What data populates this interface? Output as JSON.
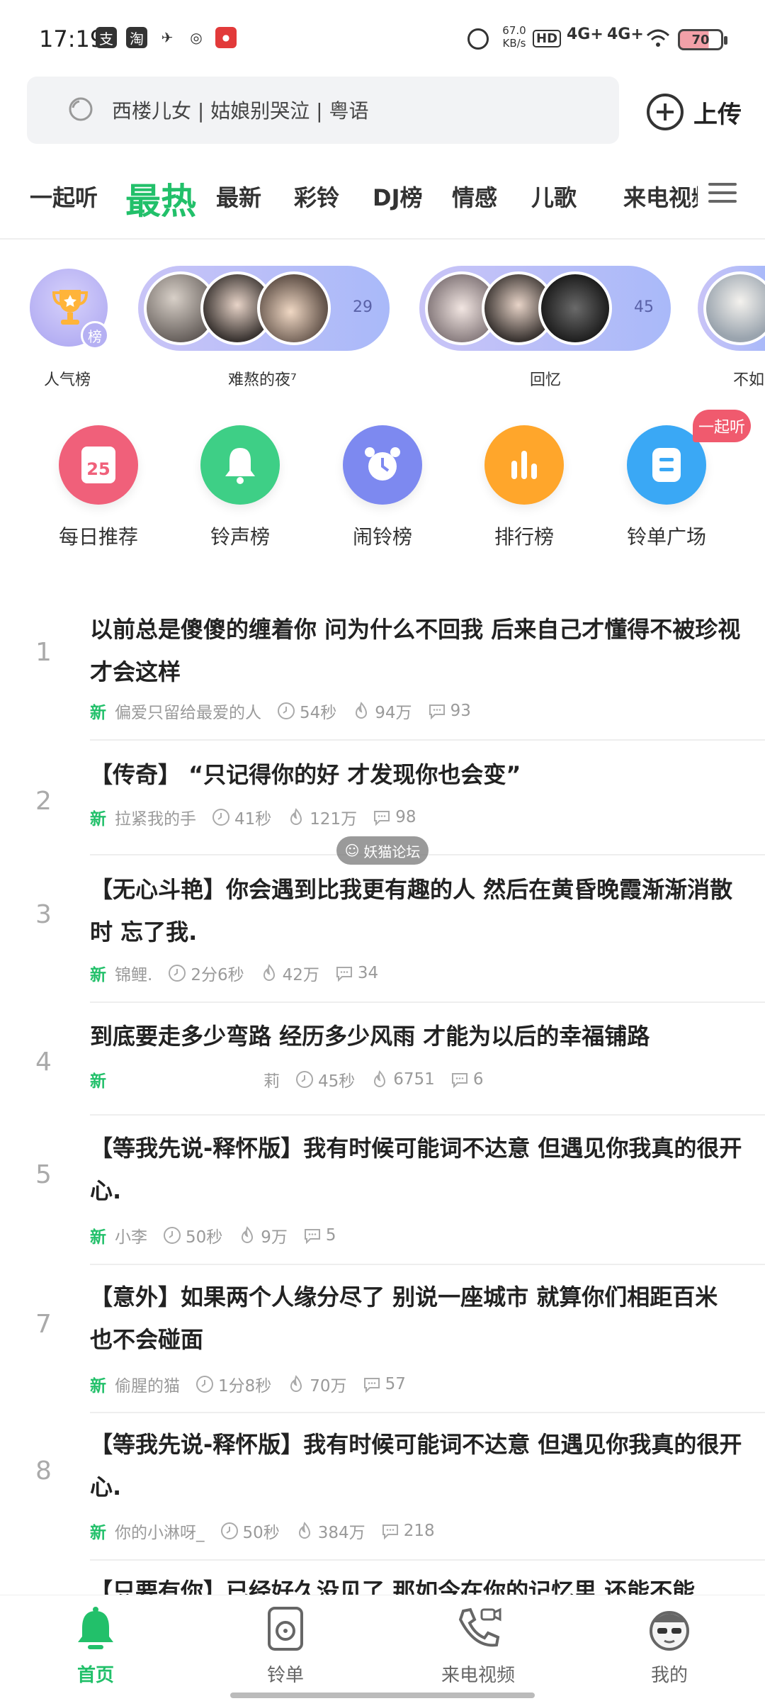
{
  "status_bar": {
    "time": "17:19",
    "net_speed_top": "67.0",
    "net_speed_unit": "KB/s",
    "hd_label": "HD",
    "sim1": "4G+",
    "sim2": "4G+",
    "battery": "70"
  },
  "search": {
    "placeholder": "西楼儿女 | 姑娘别哭泣 | 粤语"
  },
  "upload": {
    "label": "上传"
  },
  "tabs": [
    "一起听",
    "最热",
    "最新",
    "彩铃",
    "DJ榜",
    "情感",
    "儿歌",
    "来电视频"
  ],
  "active_tab": "最热",
  "playlists": [
    {
      "label": "人气榜",
      "badge": "榜"
    },
    {
      "label": "难熬的夜⁷",
      "count": "29"
    },
    {
      "label": "回忆",
      "count": "45"
    },
    {
      "label": "不如"
    }
  ],
  "categories": [
    {
      "label": "每日推荐",
      "icon_text": "25",
      "color": "#f0607a"
    },
    {
      "label": "铃声榜",
      "color": "#3ecf86"
    },
    {
      "label": "闹铃榜",
      "color": "#7d89f0"
    },
    {
      "label": "排行榜",
      "color": "#ffa62b"
    },
    {
      "label": "铃单广场",
      "color": "#3aa8f5",
      "badge": "一起听"
    }
  ],
  "songs": [
    {
      "rank": "1",
      "title": "以前总是傻傻的缠着你  问为什么不回我  后来自己才懂得不被珍视才会这样",
      "new": "新",
      "author": "偏爱只留给最爱的人",
      "duration": "54秒",
      "plays": "94万",
      "comments": "93"
    },
    {
      "rank": "2",
      "title": "【传奇】 “只记得你的好 才发现你也会变”",
      "new": "新",
      "author": "拉紧我的手",
      "duration": "41秒",
      "plays": "121万",
      "comments": "98"
    },
    {
      "rank": "3",
      "title": "【无心斗艳】你会遇到比我更有趣的人 然后在黄昏晚霞渐渐消散时 忘了我.",
      "new": "新",
      "author": "锦鲤.",
      "duration": "2分6秒",
      "plays": "42万",
      "comments": "34"
    },
    {
      "rank": "4",
      "title": "到底要走多少弯路 经历多少风雨 才能为以后的幸福铺路",
      "new": "新",
      "author": "莉",
      "duration": "45秒",
      "plays": "6751",
      "comments": "6"
    },
    {
      "rank": "5",
      "title": "【等我先说-释怀版】我有时候可能词不达意 但遇见你我真的很开心.",
      "new": "新",
      "author": "小李",
      "duration": "50秒",
      "plays": "9万",
      "comments": "5"
    },
    {
      "rank": "7",
      "title": "【意外】如果两个人缘分尽了 别说一座城市 就算你们相距百米 也不会碰面",
      "new": "新",
      "author": "偷腥的猫",
      "duration": "1分8秒",
      "plays": "70万",
      "comments": "57"
    },
    {
      "rank": "8",
      "title": "【等我先说-释怀版】我有时候可能词不达意 但遇见你我真的很开心.",
      "new": "新",
      "author": "你的小淋呀_",
      "duration": "50秒",
      "plays": "384万",
      "comments": "218"
    },
    {
      "rank": "",
      "title": "【只要有你】已经好久没见了 那如今在你的记忆里 还能不能"
    }
  ],
  "watermark": "妖猫论坛",
  "bottom_nav": [
    {
      "label": "首页",
      "active": true
    },
    {
      "label": "铃单"
    },
    {
      "label": "来电视频"
    },
    {
      "label": "我的"
    }
  ],
  "colors": {
    "accent": "#22c06a",
    "text": "#222222",
    "muted": "#9a9a9a"
  }
}
